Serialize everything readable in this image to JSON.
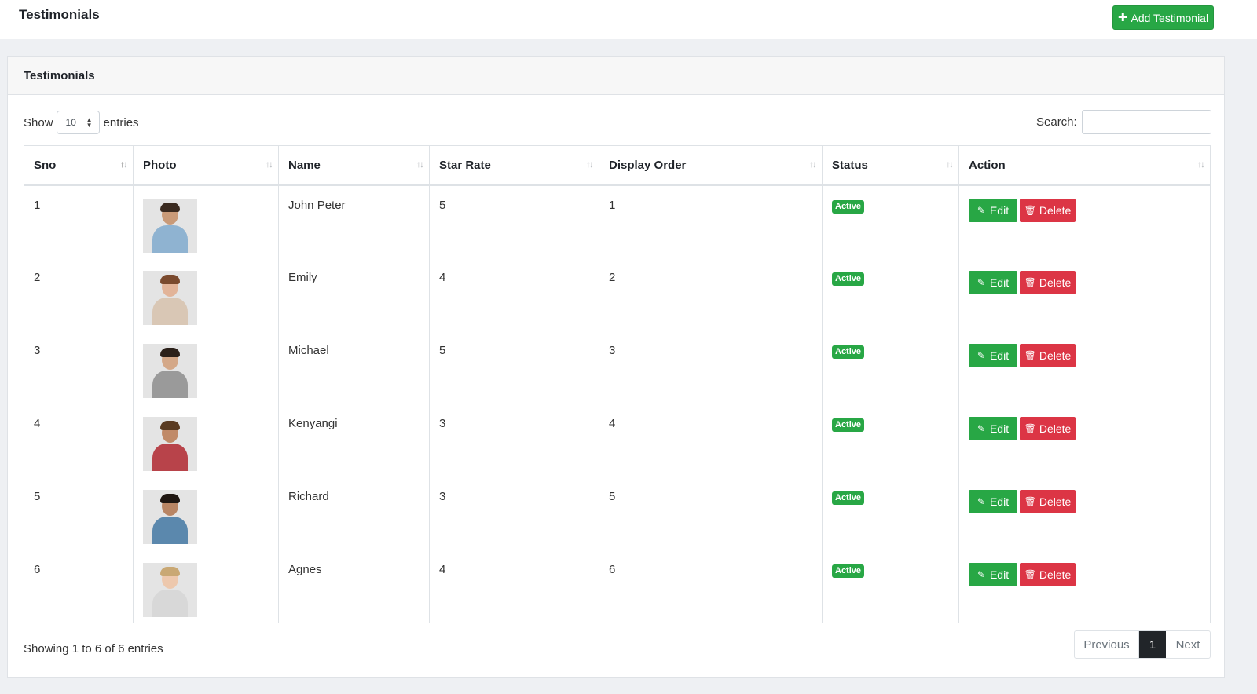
{
  "header": {
    "title": "Testimonials",
    "add_button_label": "Add Testimonial"
  },
  "card": {
    "title": "Testimonials"
  },
  "controls": {
    "show_label": "Show",
    "page_length": "10",
    "entries_label": "entries",
    "search_label": "Search:",
    "search_value": ""
  },
  "table": {
    "columns": [
      "Sno",
      "Photo",
      "Name",
      "Star Rate",
      "Display Order",
      "Status",
      "Action"
    ],
    "rows": [
      {
        "sno": "1",
        "name": "John Peter",
        "star_rate": "5",
        "display_order": "1",
        "status": "Active"
      },
      {
        "sno": "2",
        "name": "Emily",
        "star_rate": "4",
        "display_order": "2",
        "status": "Active"
      },
      {
        "sno": "3",
        "name": "Michael",
        "star_rate": "5",
        "display_order": "3",
        "status": "Active"
      },
      {
        "sno": "4",
        "name": "Kenyangi",
        "star_rate": "3",
        "display_order": "4",
        "status": "Active"
      },
      {
        "sno": "5",
        "name": "Richard",
        "star_rate": "3",
        "display_order": "5",
        "status": "Active"
      },
      {
        "sno": "6",
        "name": "Agnes",
        "star_rate": "4",
        "display_order": "6",
        "status": "Active"
      }
    ],
    "edit_label": "Edit",
    "delete_label": "Delete"
  },
  "footer": {
    "info": "Showing 1 to 6 of 6 entries",
    "previous_label": "Previous",
    "current_page": "1",
    "next_label": "Next"
  },
  "colors": {
    "success": "#28a745",
    "danger": "#dc3545",
    "active_page": "#212529"
  },
  "icons": {
    "add": "plus-icon",
    "edit": "edit-icon",
    "delete": "trash-icon",
    "sort": "sort-icon"
  }
}
